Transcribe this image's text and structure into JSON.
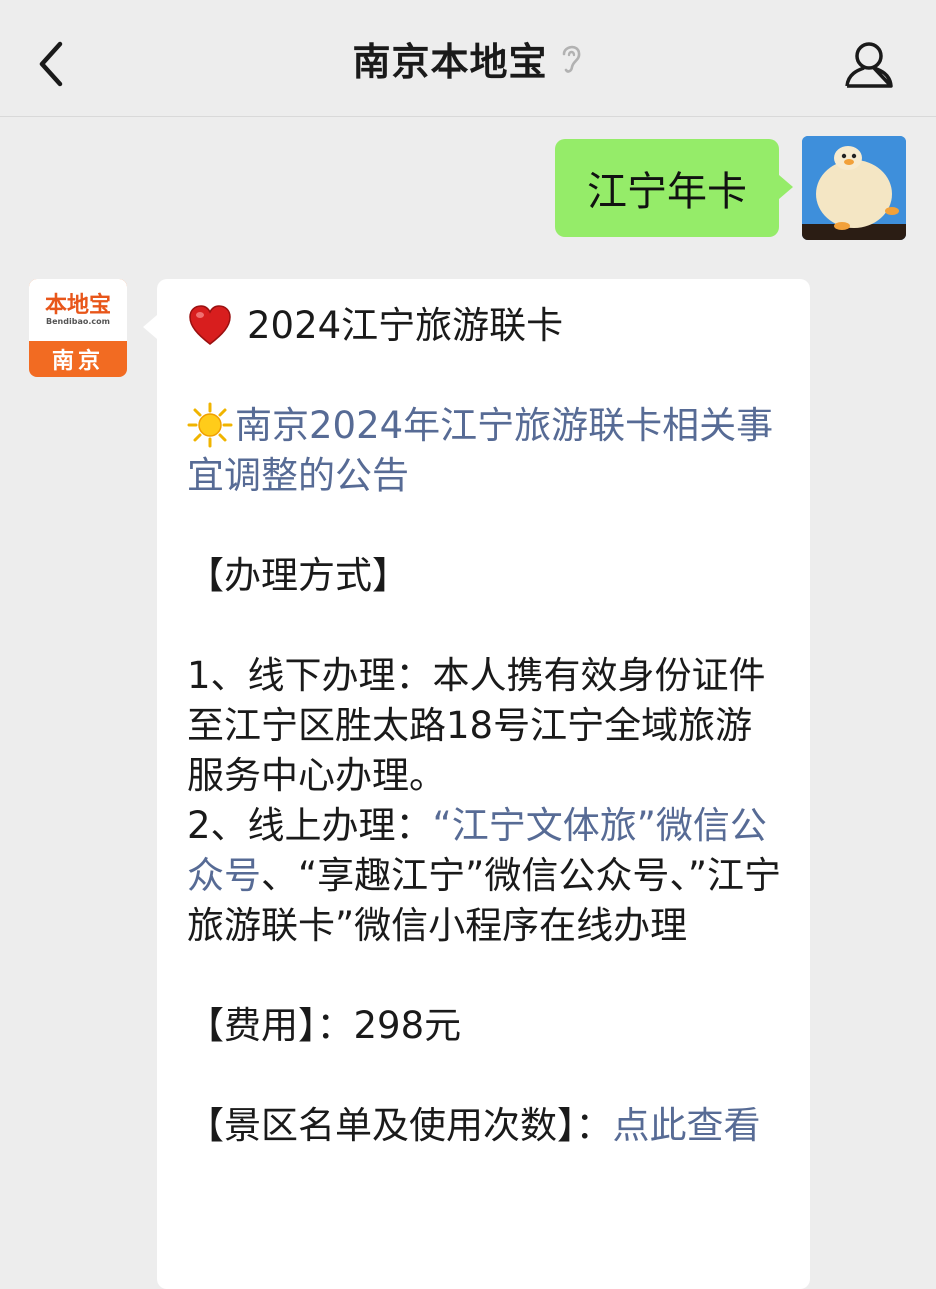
{
  "header": {
    "title": "南京本地宝"
  },
  "outgoing": {
    "text": "江宁年卡"
  },
  "bot": {
    "avatar_logo": "本地宝",
    "avatar_domain": "Bendibao.com",
    "avatar_city": "南京"
  },
  "message": {
    "line1": "2024江宁旅游联卡",
    "announce_link": "南京2024年江宁旅游联卡相关事宜调整的公告",
    "method_heading": "【办理方式】",
    "offline": "1、线下办理：本人携有效身份证件至江宁区胜太路18号江宁全域旅游服务中心办理。",
    "online_prefix": "2、线上办理：",
    "online_link1": "“江宁文体旅”微信公众号",
    "online_mid": "、“享趣江宁”微信公众号、”江宁旅游联卡”微信小程序在线办理",
    "fee": "【费用】：298元",
    "scenic_label": "【景区名单及使用次数】：",
    "scenic_link": "点此查看"
  },
  "colors": {
    "background": "#ededed",
    "outgoing_bubble": "#95ec69",
    "incoming_bubble": "#ffffff",
    "link": "#576b95",
    "brand_orange": "#f26b22"
  },
  "icons": [
    "back-icon",
    "ear-icon",
    "profile-icon",
    "heart-icon",
    "sun-icon"
  ]
}
